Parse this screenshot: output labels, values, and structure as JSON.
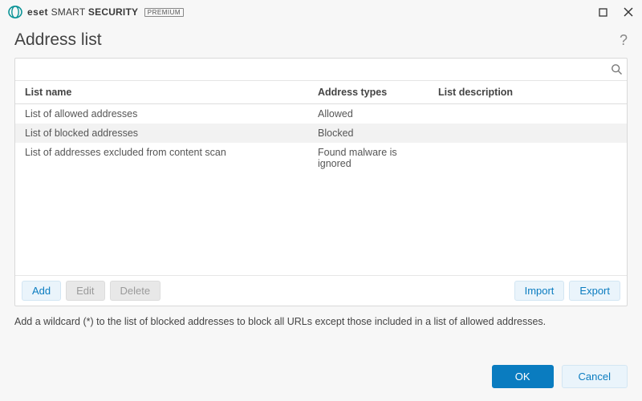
{
  "titlebar": {
    "brand_eset": "eset",
    "brand_smart": "SMART",
    "brand_security": "SECURITY",
    "brand_premium": "PREMIUM"
  },
  "header": {
    "title": "Address list"
  },
  "search": {
    "value": "",
    "placeholder": ""
  },
  "columns": {
    "name": "List name",
    "types": "Address types",
    "desc": "List description"
  },
  "rows": [
    {
      "name": "List of allowed addresses",
      "types": "Allowed",
      "desc": ""
    },
    {
      "name": "List of blocked addresses",
      "types": "Blocked",
      "desc": ""
    },
    {
      "name": "List of addresses excluded from content scan",
      "types": "Found malware is ignored",
      "desc": ""
    }
  ],
  "actions": {
    "add": "Add",
    "edit": "Edit",
    "delete": "Delete",
    "import": "Import",
    "export": "Export"
  },
  "hint": "Add a wildcard (*) to the list of blocked addresses to block all URLs except those included in a list of allowed addresses.",
  "footer": {
    "ok": "OK",
    "cancel": "Cancel"
  }
}
